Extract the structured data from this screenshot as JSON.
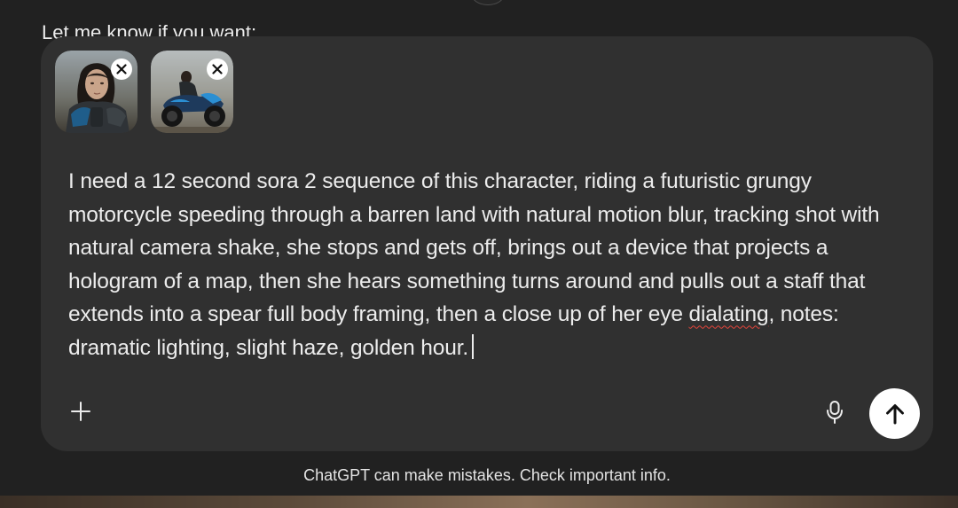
{
  "conversation": {
    "previous_message": "Let me know if you want:"
  },
  "composer": {
    "attachments": [
      {
        "name": "character portrait",
        "remove_icon": "close-icon"
      },
      {
        "name": "motorcycle rider",
        "remove_icon": "close-icon"
      }
    ],
    "prompt": {
      "before_typo": "I need a 12 second sora 2 sequence of this character, riding a futuristic grungy motorcycle speeding through a barren land with natural motion blur, tracking shot with natural camera shake, she stops and gets off, brings out a device that projects a hologram of a map, then she hears something turns around and pulls out a staff that extends into a spear full body framing, then a close up of her eye ",
      "typo_word": "dialating",
      "after_typo": ", notes: dramatic lighting, slight haze, golden hour."
    },
    "icons": {
      "add": "plus-icon",
      "voice": "microphone-icon",
      "send": "arrow-up-icon"
    }
  },
  "footer": {
    "disclaimer": "ChatGPT can make mistakes. Check important info."
  },
  "colors": {
    "background": "#212121",
    "composer": "#303030",
    "text": "#ececec",
    "send_button": "#ffffff",
    "spellcheck_underline": "#e5453b"
  }
}
